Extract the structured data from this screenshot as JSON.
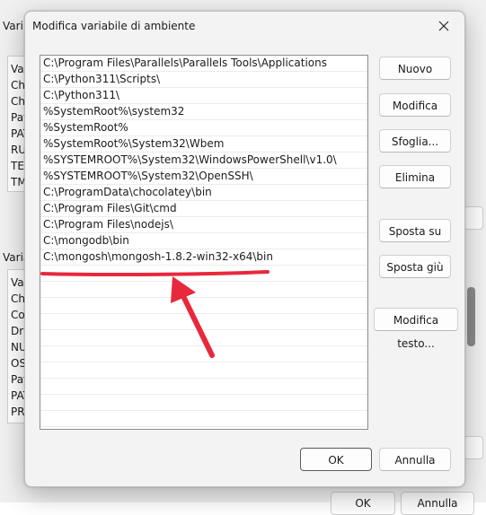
{
  "background": {
    "user_section_label": "Vari",
    "user_items": [
      "Va",
      "Ch",
      "Ch",
      "Pat",
      "PAT",
      "RU",
      "TEI",
      "TM"
    ],
    "system_section_label": "Varia",
    "system_items": [
      "Va",
      "Ch",
      "Co",
      "Dri",
      "NU",
      "OS",
      "Pat",
      "PAT",
      "PR("
    ],
    "ok_label": "OK",
    "cancel_label": "Annulla"
  },
  "dialog": {
    "title": "Modifica variabile di ambiente",
    "entries": [
      "C:\\Program Files\\Parallels\\Parallels Tools\\Applications",
      "C:\\Python311\\Scripts\\",
      "C:\\Python311\\",
      "%SystemRoot%\\system32",
      "%SystemRoot%",
      "%SystemRoot%\\System32\\Wbem",
      "%SYSTEMROOT%\\System32\\WindowsPowerShell\\v1.0\\",
      "%SYSTEMROOT%\\System32\\OpenSSH\\",
      "C:\\ProgramData\\chocolatey\\bin",
      "C:\\Program Files\\Git\\cmd",
      "C:\\Program Files\\nodejs\\",
      "C:\\mongodb\\bin",
      "C:\\mongosh\\mongosh-1.8.2-win32-x64\\bin"
    ],
    "buttons": {
      "new": "Nuovo",
      "edit": "Modifica",
      "browse": "Sfoglia...",
      "delete": "Elimina",
      "move_up": "Sposta su",
      "move_down": "Sposta giù",
      "edit_text": "Modifica testo...",
      "ok": "OK",
      "cancel": "Annulla"
    }
  },
  "colors": {
    "annotation": "#e8283c",
    "list_border": "#8c8c8c",
    "dialog_bg": "#f3f3f3"
  }
}
